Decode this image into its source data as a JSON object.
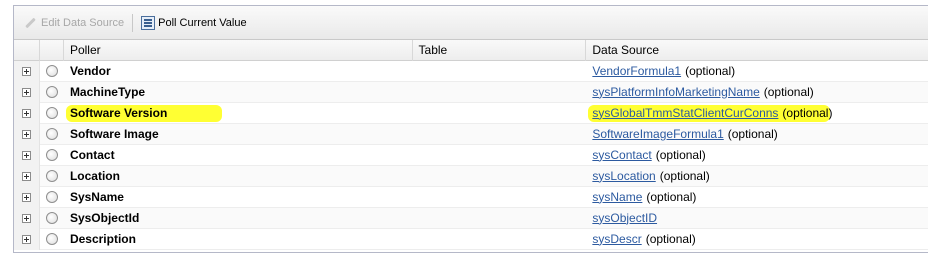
{
  "toolbar": {
    "edit_label": "Edit Data Source",
    "poll_label": "Poll Current Value"
  },
  "columns": {
    "poller": "Poller",
    "table": "Table",
    "data_source": "Data Source"
  },
  "highlight_color": "#ffff33",
  "link_color": "#2c5aa0",
  "rows": [
    {
      "poller": "Vendor",
      "table": "",
      "ds": "VendorFormula1",
      "opt": "(optional)"
    },
    {
      "poller": "MachineType",
      "table": "",
      "ds": "sysPlatformInfoMarketingName",
      "opt": "(optional)"
    },
    {
      "poller": "Software Version",
      "table": "",
      "ds": "sysGlobalTmmStatClientCurConns",
      "opt": "(optional)"
    },
    {
      "poller": "Software Image",
      "table": "",
      "ds": "SoftwareImageFormula1",
      "opt": "(optional)"
    },
    {
      "poller": "Contact",
      "table": "",
      "ds": "sysContact",
      "opt": "(optional)"
    },
    {
      "poller": "Location",
      "table": "",
      "ds": "sysLocation",
      "opt": "(optional)"
    },
    {
      "poller": "SysName",
      "table": "",
      "ds": "sysName",
      "opt": "(optional)"
    },
    {
      "poller": "SysObjectId",
      "table": "",
      "ds": "sysObjectID",
      "opt": ""
    },
    {
      "poller": "Description",
      "table": "",
      "ds": "sysDescr",
      "opt": "(optional)"
    }
  ]
}
